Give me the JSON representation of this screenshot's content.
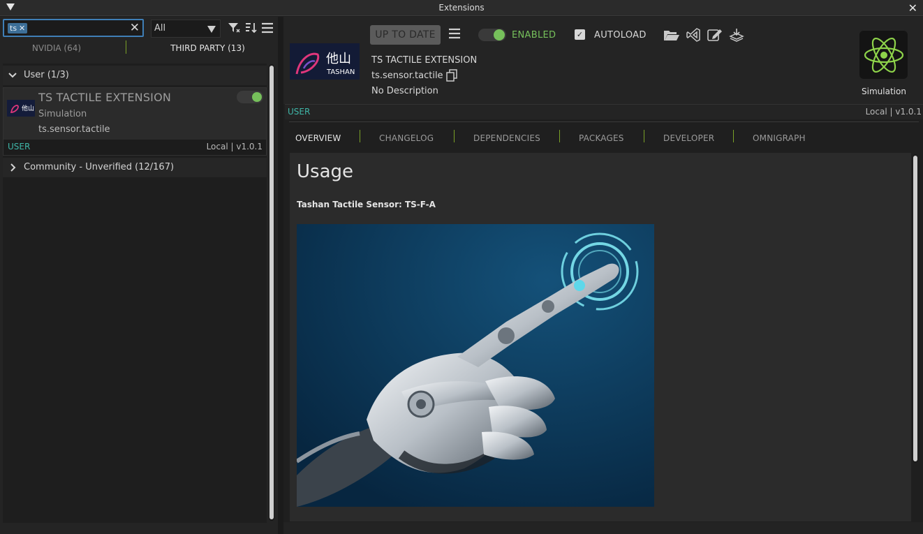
{
  "window": {
    "title": "Extensions"
  },
  "search": {
    "chip": "ts",
    "placeholder": ""
  },
  "filter": {
    "selected": "All"
  },
  "tabs": [
    {
      "label": "NVIDIA (64)"
    },
    {
      "label": "THIRD PARTY (13)"
    }
  ],
  "groups": {
    "user": {
      "label": "User (1/3)"
    },
    "community": {
      "label": "Community - Unverified (12/167)"
    }
  },
  "list_item": {
    "name": "TS TACTILE EXTENSION",
    "category": "Simulation",
    "package": "ts.sensor.tactile",
    "tag": "USER",
    "version": "Local | v1.0.1",
    "enabled": true
  },
  "detail": {
    "status_button": "UP TO DATE",
    "enabled_label": "ENABLED",
    "autoload_label": "AUTOLOAD",
    "title": "TS TACTILE EXTENSION",
    "package": "ts.sensor.tactile",
    "description": "No Description",
    "category_label": "Simulation",
    "user_tag": "USER",
    "version": "Local | v1.0.1",
    "logo_text_cjk": "他山",
    "logo_text": "TASHAN",
    "tabs": [
      "OVERVIEW",
      "CHANGELOG",
      "DEPENDENCIES",
      "PACKAGES",
      "DEVELOPER",
      "OMNIGRAPH"
    ],
    "overview": {
      "heading": "Usage",
      "subtitle": "Tashan Tactile Sensor: TS-F-A"
    }
  },
  "colors": {
    "accent_green": "#76c05b",
    "user_teal": "#3fb6a8",
    "tab_separator": "#7aa127",
    "focus_blue": "#3f7fb7"
  },
  "icons": [
    "collapse-triangle-icon",
    "close-icon",
    "clear-icon",
    "filter-icon",
    "sort-icon",
    "menu-icon",
    "folder-open-icon",
    "vscode-icon",
    "edit-icon",
    "export-icon",
    "copy-icon",
    "atom-icon",
    "chevron-down-icon",
    "chevron-right-icon",
    "checkbox-icon"
  ]
}
